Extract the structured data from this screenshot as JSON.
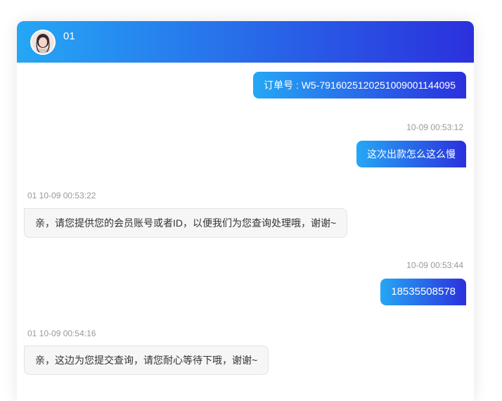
{
  "header": {
    "avatar_icon": "user-avatar-photo",
    "name": "01"
  },
  "colors": {
    "gradient_start": "#25a7f5",
    "gradient_end": "#2b30dd",
    "incoming_bubble": "#f6f6f6",
    "meta_text": "#999999"
  },
  "messages": [
    {
      "direction": "out",
      "text": "订单号 : W5-79160251202510090011440​95"
    },
    {
      "direction": "out",
      "time": "10-09 00:53:12",
      "text": "这次出款怎么这么慢"
    },
    {
      "direction": "in",
      "sender_time": "01 10-09 00:53:22",
      "text": "亲，请您提供您的会员账号或者ID，以便我们为您查询处理哦，谢谢~"
    },
    {
      "direction": "out",
      "time": "10-09 00:53:44",
      "text": "18535508578"
    },
    {
      "direction": "in",
      "sender_time": "01 10-09 00:54:16",
      "text": "亲，这边为您提交查询，请您耐心等待下哦，谢谢~"
    }
  ]
}
